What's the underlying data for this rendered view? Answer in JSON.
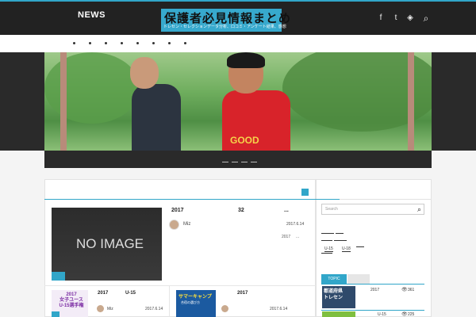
{
  "header": {
    "nav_news": "NEWS",
    "logo_title": "保護者必見情報まとめ",
    "logo_subtitle": "トレセン・セレクションデータ分析、口コミ・アンケート結果、感想",
    "social_icons": [
      "facebook-icon",
      "twitter-icon",
      "feedly-icon",
      "search-icon"
    ],
    "social_glyphs": [
      "f",
      "t",
      "◈",
      "⌕"
    ]
  },
  "subnav": {
    "dot_count": 8
  },
  "hero": {
    "shirt_text": "GOOD"
  },
  "featured": {
    "thumb_text": "NO IMAGE",
    "year": "2017",
    "number": "32",
    "ellipsis": "...",
    "author": "Miz",
    "date": "2017.6.14",
    "excerpt_a": "2017",
    "excerpt_b": "..."
  },
  "cards": [
    {
      "thumb_text": "2017\n女子ユース\nU-15選手権",
      "title": "2017",
      "tag": "U-15",
      "author": "Miz",
      "date": "2017.6.14"
    },
    {
      "thumb_text": "サマーキャンプ",
      "thumb_sub": "合宿の選び方",
      "title": "2017",
      "author": "",
      "date": "2017.6.14"
    }
  ],
  "sidebar": {
    "search_placeholder": "Search",
    "categories": [
      "U-15",
      "U-18"
    ],
    "tabs": [
      "TOPIC"
    ],
    "popular": [
      {
        "thumb_text": "都道府県\nトレセン",
        "title": "2017",
        "views": "361"
      },
      {
        "thumb_text": "",
        "title": "U-15",
        "views": "225"
      }
    ]
  },
  "colors": {
    "accent": "#31a6c9",
    "header_bg": "#222222"
  }
}
